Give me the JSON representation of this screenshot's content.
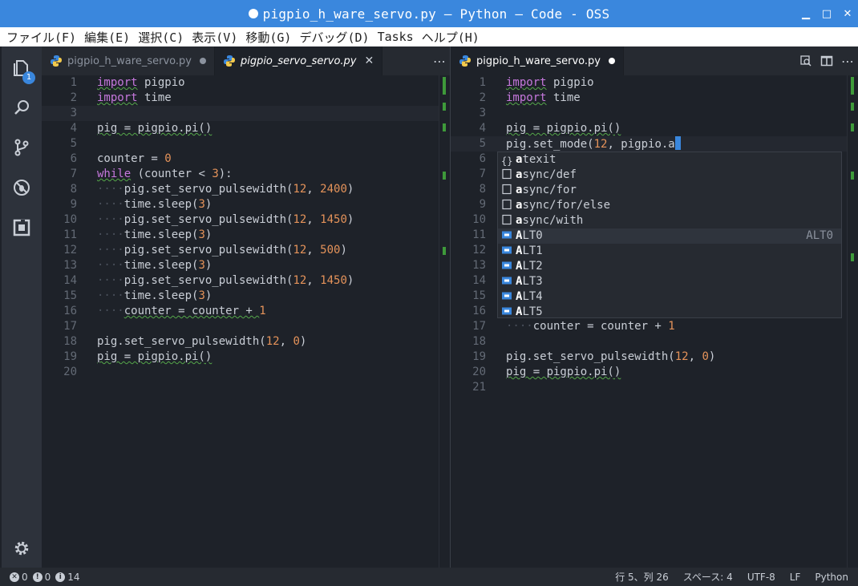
{
  "window": {
    "title": "pigpio_h_ware_servo.py — Python — Code - OSS",
    "controls": [
      "minimize",
      "maximize",
      "close"
    ]
  },
  "menu": [
    "ファイル(F)",
    "編集(E)",
    "選択(C)",
    "表示(V)",
    "移動(G)",
    "デバッグ(D)",
    "Tasks",
    "ヘルプ(H)"
  ],
  "activity": {
    "explorer_badge": "1"
  },
  "group1": {
    "tabs": [
      {
        "label": "pigpio_h_ware_servo.py",
        "state": "dirty"
      },
      {
        "label": "pigpio_servo_servo.py",
        "state": "close"
      }
    ],
    "lines": [
      {
        "n": "1"
      },
      {
        "n": "2"
      },
      {
        "n": "3"
      },
      {
        "n": "4"
      },
      {
        "n": "5"
      },
      {
        "n": "6"
      },
      {
        "n": "7"
      },
      {
        "n": "8"
      },
      {
        "n": "9"
      },
      {
        "n": "10"
      },
      {
        "n": "11"
      },
      {
        "n": "12"
      },
      {
        "n": "13"
      },
      {
        "n": "14"
      },
      {
        "n": "15"
      },
      {
        "n": "16"
      },
      {
        "n": "17"
      },
      {
        "n": "18"
      },
      {
        "n": "19"
      },
      {
        "n": "20"
      }
    ],
    "code": {
      "l1_kw": "import",
      "l1_rest": " pigpio",
      "l2_kw": "import",
      "l2_rest": " time",
      "l4": "pig = pigpio.pi()",
      "l6_a": "counter = ",
      "l6_n": "0",
      "l7_kw": "while",
      "l7_a": " (counter < ",
      "l7_n": "3",
      "l7_b": "):",
      "l8_a": "pig.set_servo_pulsewidth(",
      "l8_n1": "12",
      "l8_sep": ", ",
      "l8_n2": "2400",
      "l8_b": ")",
      "l9_a": "time.sleep(",
      "l9_n": "3",
      "l9_b": ")",
      "l10_a": "pig.set_servo_pulsewidth(",
      "l10_n1": "12",
      "l10_sep": ", ",
      "l10_n2": "1450",
      "l10_b": ")",
      "l11_a": "time.sleep(",
      "l11_n": "3",
      "l11_b": ")",
      "l12_a": "pig.set_servo_pulsewidth(",
      "l12_n1": "12",
      "l12_sep": ", ",
      "l12_n2": "500",
      "l12_b": ")",
      "l13_a": "time.sleep(",
      "l13_n": "3",
      "l13_b": ")",
      "l14_a": "pig.set_servo_pulsewidth(",
      "l14_n1": "12",
      "l14_sep": ", ",
      "l14_n2": "1450",
      "l14_b": ")",
      "l15_a": "time.sleep(",
      "l15_n": "3",
      "l15_b": ")",
      "l16_a": "counter = counter + ",
      "l16_n": "1",
      "l18_a": "pig.set_servo_pulsewidth(",
      "l18_n1": "12",
      "l18_sep": ", ",
      "l18_n2": "0",
      "l18_b": ")",
      "l19": "pig = pigpio.pi()"
    }
  },
  "group2": {
    "tabs": [
      {
        "label": "pigpio_h_ware_servo.py",
        "state": "dirty"
      }
    ],
    "lines": [
      {
        "n": "1"
      },
      {
        "n": "2"
      },
      {
        "n": "3"
      },
      {
        "n": "4"
      },
      {
        "n": "5"
      },
      {
        "n": "6"
      },
      {
        "n": "7"
      },
      {
        "n": "8"
      },
      {
        "n": "9"
      },
      {
        "n": "10"
      },
      {
        "n": "11"
      },
      {
        "n": "12"
      },
      {
        "n": "13"
      },
      {
        "n": "14"
      },
      {
        "n": "15"
      },
      {
        "n": "16"
      },
      {
        "n": "17"
      },
      {
        "n": "18"
      },
      {
        "n": "19"
      },
      {
        "n": "20"
      },
      {
        "n": "21"
      }
    ],
    "code": {
      "l1_kw": "import",
      "l1_rest": " pigpio",
      "l2_kw": "import",
      "l2_rest": " time",
      "l4": "pig = pigpio.pi()",
      "l5_a": "pig.set_mode(",
      "l5_n": "12",
      "l5_b": ", pigpio.a",
      "l17_a": "counter = counter + ",
      "l17_n": "1",
      "l19_a": "pig.set_servo_pulsewidth(",
      "l19_n1": "12",
      "l19_sep": ", ",
      "l19_n2": "0",
      "l19_b": ")",
      "l20": "pig = pigpio.pi()"
    },
    "suggestions": [
      {
        "bold": "a",
        "rest": "texit",
        "kind": "module",
        "detail": ""
      },
      {
        "bold": "a",
        "rest": "sync/def",
        "kind": "snippet",
        "detail": ""
      },
      {
        "bold": "a",
        "rest": "sync/for",
        "kind": "snippet",
        "detail": ""
      },
      {
        "bold": "a",
        "rest": "sync/for/else",
        "kind": "snippet",
        "detail": ""
      },
      {
        "bold": "a",
        "rest": "sync/with",
        "kind": "snippet",
        "detail": ""
      },
      {
        "bold": "A",
        "rest": "LT0",
        "kind": "enum",
        "detail": "ALT0"
      },
      {
        "bold": "A",
        "rest": "LT1",
        "kind": "enum",
        "detail": ""
      },
      {
        "bold": "A",
        "rest": "LT2",
        "kind": "enum",
        "detail": ""
      },
      {
        "bold": "A",
        "rest": "LT3",
        "kind": "enum",
        "detail": ""
      },
      {
        "bold": "A",
        "rest": "LT4",
        "kind": "enum",
        "detail": ""
      },
      {
        "bold": "A",
        "rest": "LT5",
        "kind": "enum",
        "detail": ""
      }
    ]
  },
  "status": {
    "errors": "0",
    "warnings": "0",
    "infos": "14",
    "position": "行 5、列 26",
    "indent": "スペース: 4",
    "encoding": "UTF-8",
    "eol": "LF",
    "language": "Python"
  }
}
